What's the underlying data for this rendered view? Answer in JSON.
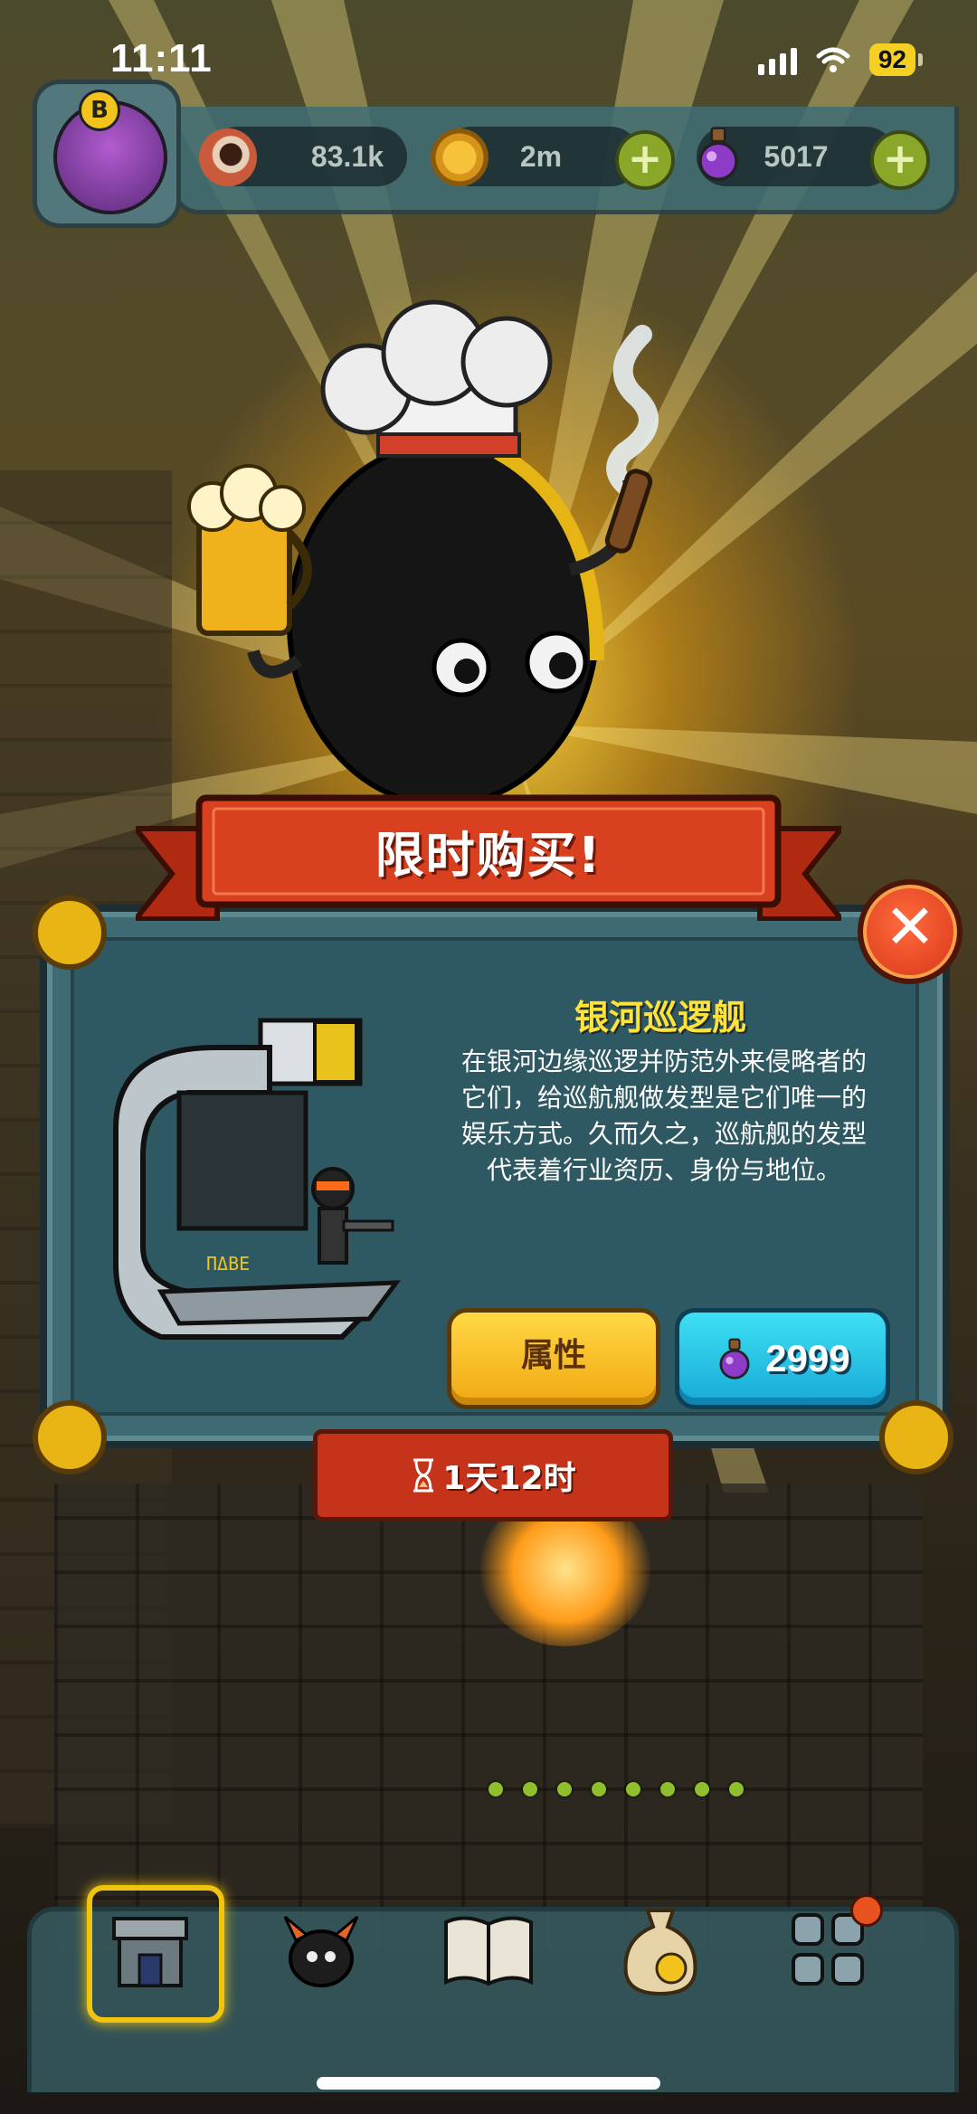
{
  "status_bar": {
    "time": "11:11",
    "battery": "92"
  },
  "resources": {
    "eyes": {
      "value": "83.1k",
      "icon": "eyeball-icon"
    },
    "coins": {
      "value": "2m",
      "icon": "coin-icon"
    },
    "potions": {
      "value": "5017",
      "icon": "potion-icon"
    }
  },
  "profile": {
    "badge": "B"
  },
  "offer": {
    "banner_title": "限时购买!",
    "item_name": "银河巡逻舰",
    "item_description_lines": [
      "在银河边缘巡逻并防范外来侵略者的",
      "它们，给巡航舰做发型是它们唯一的",
      "娱乐方式。久而久之，巡航舰的发型",
      "代表着行业资历、身份与地位。"
    ],
    "attributes_label": "属性",
    "price": "2999",
    "price_icon": "potion-icon",
    "timer": "1天12时",
    "timer_icon": "hourglass-icon"
  },
  "bottom_nav": [
    {
      "icon": "shop-building-icon",
      "selected": true
    },
    {
      "icon": "monster-icon",
      "selected": false
    },
    {
      "icon": "book-icon",
      "selected": false
    },
    {
      "icon": "coin-bag-icon",
      "selected": false
    },
    {
      "icon": "grid-menu-icon",
      "selected": false,
      "has_notification": true
    }
  ],
  "colors": {
    "accent_yellow": "#ffe23a",
    "panel_teal": "#3e6a73",
    "banner_red": "#c4331a",
    "button_yellow": "#f1a812",
    "button_cyan": "#17a9d6"
  }
}
